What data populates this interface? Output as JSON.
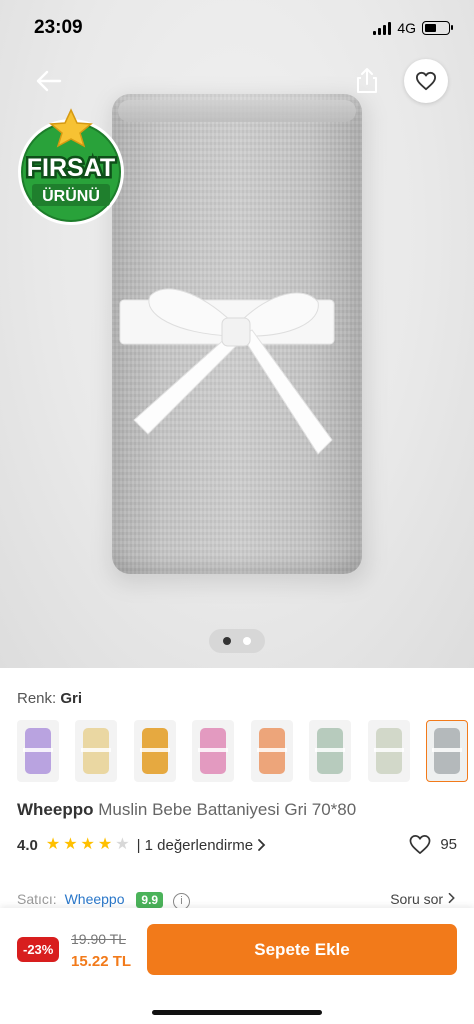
{
  "status_bar": {
    "time": "23:09",
    "network": "4G",
    "battery_level": 0.5,
    "signal_bars": 4
  },
  "navigation": {
    "back_icon": "arrow-left-icon",
    "share_icon": "share-icon",
    "favorite_icon": "heart-outline-icon"
  },
  "badge": {
    "line1": "FIRSAT",
    "line2": "ÜRÜNÜ",
    "icon": "star-icon"
  },
  "gallery": {
    "image_count": 2,
    "active_index": 0
  },
  "color_selector": {
    "label": "Renk:",
    "selected": "Gri",
    "swatches": [
      {
        "color": "#b9a3e0",
        "selected": false
      },
      {
        "color": "#ead7a2",
        "selected": false
      },
      {
        "color": "#e6a940",
        "selected": false
      },
      {
        "color": "#e39ac0",
        "selected": false
      },
      {
        "color": "#eda57a",
        "selected": false
      },
      {
        "color": "#b7cbbd",
        "selected": false
      },
      {
        "color": "#d2d8c9",
        "selected": false
      },
      {
        "color": "#b4b9bb",
        "selected": true
      }
    ]
  },
  "product": {
    "brand": "Wheeppo",
    "name": "Muslin Bebe Battaniyesi Gri 70*80",
    "rating": "4.0",
    "rating_value": 4,
    "rating_max": 5,
    "reviews_text": "| 1 değerlendirme",
    "favorites": "95"
  },
  "seller": {
    "label": "Satıcı:",
    "name": "Wheeppo",
    "score": "9.9",
    "ask_label": "Soru sor"
  },
  "purchase": {
    "discount": "-23%",
    "old_price": "19.90 TL",
    "new_price": "15.22 TL",
    "cart_button": "Sepete Ekle"
  },
  "colors": {
    "accent": "#f27a1a",
    "discount": "#d81e1e",
    "seller_score": "#4bb35a",
    "link": "#2a77c9"
  }
}
